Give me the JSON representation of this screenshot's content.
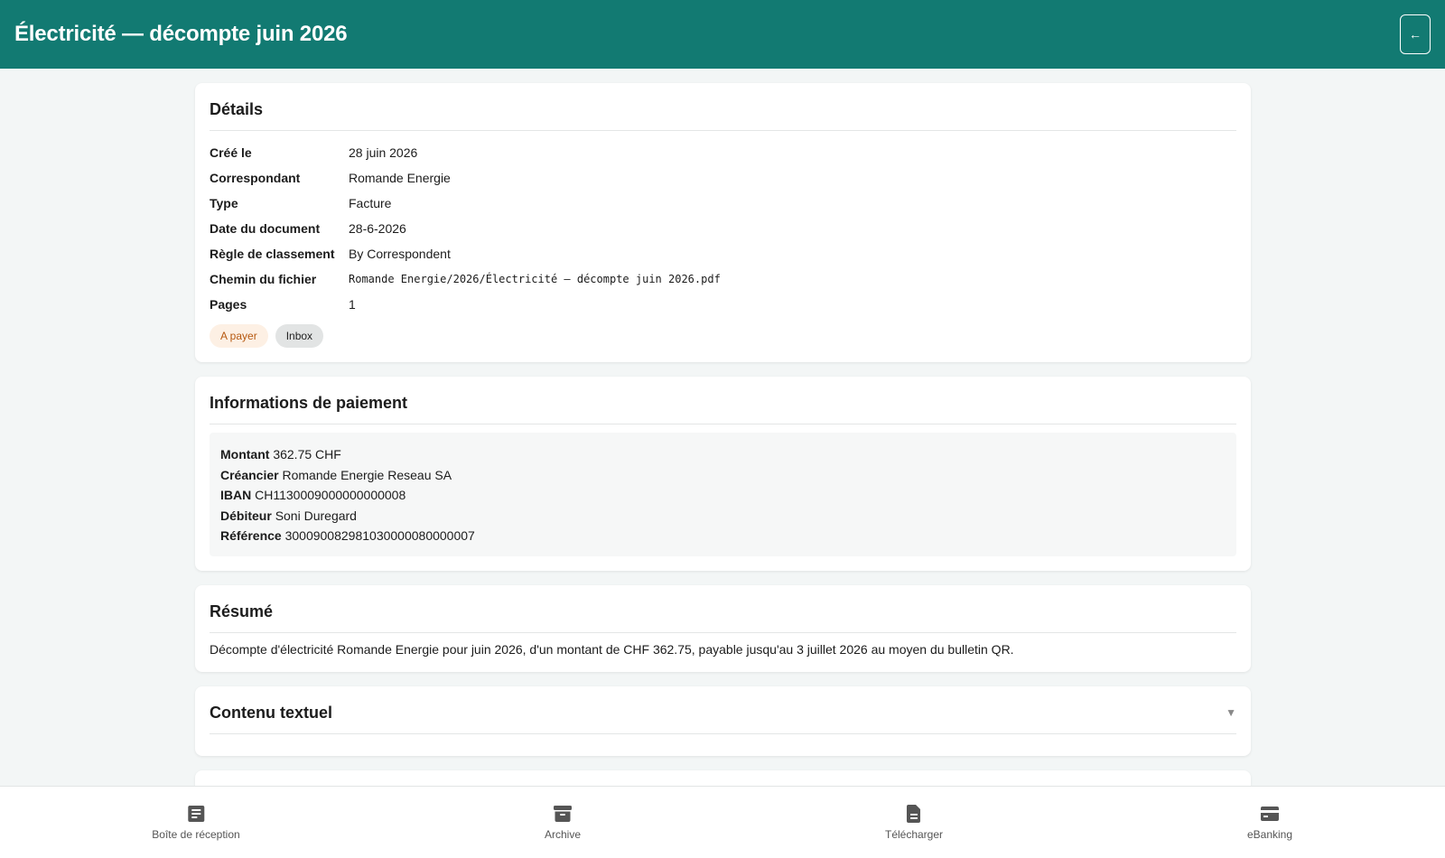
{
  "header": {
    "title": "Électricité — décompte juin 2026",
    "back_label": "←"
  },
  "details": {
    "title": "Détails",
    "rows": [
      {
        "label": "Créé le",
        "value": "28 juin 2026"
      },
      {
        "label": "Correspondant",
        "value": "Romande Energie"
      },
      {
        "label": "Type",
        "value": "Facture"
      },
      {
        "label": "Date du document",
        "value": "28-6-2026"
      },
      {
        "label": "Règle de classement",
        "value": "By Correspondent"
      },
      {
        "label": "Chemin du fichier",
        "value": "Romande Energie/2026/Électricité — décompte juin 2026.pdf"
      },
      {
        "label": "Pages",
        "value": "1"
      }
    ],
    "tags": [
      {
        "label": "A payer",
        "color": "#b6580f",
        "bg": "#fdf0e4"
      },
      {
        "label": "Inbox",
        "color": "#222222",
        "bg": "#e2e4e4"
      }
    ]
  },
  "payment": {
    "title": "Informations de paiement",
    "fields": [
      {
        "label": "Montant",
        "value": "362.75 CHF"
      },
      {
        "label": "Créancier",
        "value": "Romande Energie Reseau SA"
      },
      {
        "label": "IBAN",
        "value": "CH1130009000000000008"
      },
      {
        "label": "Débiteur",
        "value": "Soni Duregard"
      },
      {
        "label": "Référence",
        "value": "300090082981030000080000007"
      }
    ]
  },
  "summary": {
    "title": "Résumé",
    "text": "Décompte d'électricité Romande Energie pour juin 2026, d'un montant de CHF 362.75, payable jusqu'au 3 juillet 2026 au moyen du bulletin QR."
  },
  "text_content": {
    "title": "Contenu textuel",
    "chevron": "▼"
  },
  "bottom_nav": [
    {
      "label": "Boîte de réception",
      "icon": "inbox-icon"
    },
    {
      "label": "Archive",
      "icon": "archive-icon"
    },
    {
      "label": "Télécharger",
      "icon": "document-icon"
    },
    {
      "label": "eBanking",
      "icon": "credit-card-icon"
    }
  ],
  "colors": {
    "header_bg": "#127a72",
    "page_bg": "#f3f6f6",
    "accent_tag": "#b6580f"
  }
}
